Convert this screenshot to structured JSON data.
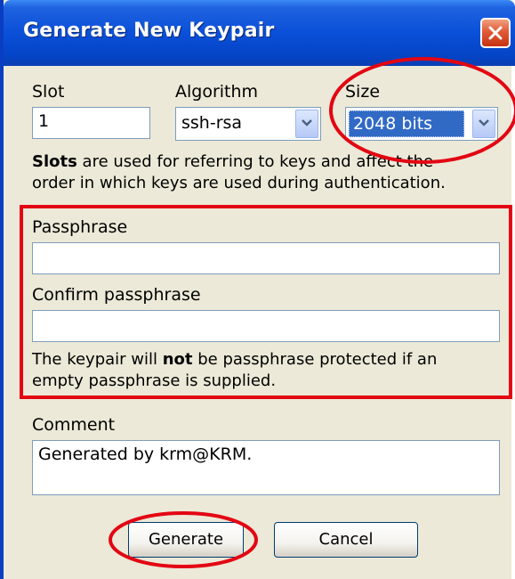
{
  "window": {
    "title": "Generate New Keypair"
  },
  "labels": {
    "slot": "Slot",
    "algorithm": "Algorithm",
    "size": "Size",
    "passphrase": "Passphrase",
    "confirm": "Confirm passphrase",
    "comment": "Comment"
  },
  "fields": {
    "slot_value": "1",
    "algorithm_value": "ssh-rsa",
    "size_value": "2048 bits",
    "passphrase_value": "",
    "confirm_value": "",
    "comment_value": "Generated by krm@KRM."
  },
  "info": {
    "slots_bold": "Slots",
    "slots_rest": " are used for referring to keys and affect the order in which keys are used during authentication.",
    "pp_pre": "The keypair will ",
    "pp_bold": "not",
    "pp_post": " be passphrase protected if an empty passphrase is supplied."
  },
  "buttons": {
    "generate": "Generate",
    "cancel": "Cancel"
  },
  "colors": {
    "titlebar": "#0a50d8",
    "dialog_bg": "#ece9d8",
    "selection": "#316ac5",
    "annotation": "#e30613"
  }
}
